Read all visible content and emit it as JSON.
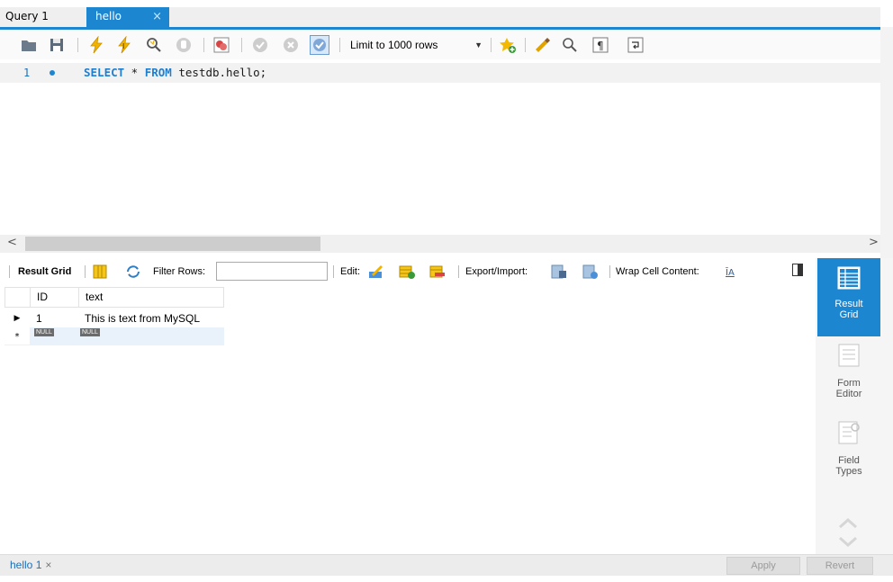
{
  "tabs": [
    {
      "label": "Query 1",
      "active": false
    },
    {
      "label": "hello",
      "active": true,
      "close": "×"
    }
  ],
  "toolbar": {
    "limit_select": "Limit to 1000 rows",
    "icons": [
      "open-folder-icon",
      "save-icon",
      "execute-icon",
      "execute-current-icon",
      "explain-icon",
      "stop-icon",
      "toggle-error-icon",
      "commit-icon",
      "rollback-icon",
      "autocommit-icon",
      "add-snippet-icon",
      "beautify-icon",
      "find-icon",
      "invisible-chars-icon",
      "wrap-lines-icon"
    ]
  },
  "editor": {
    "line_number": "1",
    "code_kw1": "SELECT",
    "code_mid": " * ",
    "code_kw2": "FROM",
    "code_rest": " testdb.hello;"
  },
  "result_toolbar": {
    "result_grid": "Result Grid",
    "filter_rows": "Filter Rows:",
    "edit": "Edit:",
    "export_import": "Export/Import:",
    "wrap_cell": "Wrap Cell Content:"
  },
  "grid": {
    "columns": [
      "ID",
      "text"
    ],
    "rows": [
      {
        "id": "1",
        "text": "This is text from MySQL"
      }
    ],
    "null_label": "NULL",
    "new_row_marker": "*",
    "current_row_marker": "▶"
  },
  "side_panel": {
    "result_grid": [
      "Result",
      "Grid"
    ],
    "form_editor": [
      "Form",
      "Editor"
    ],
    "field_types": [
      "Field",
      "Types"
    ]
  },
  "bottom": {
    "tab_label": "hello 1",
    "tab_close": "×",
    "apply": "Apply",
    "revert": "Revert"
  },
  "scroll": {
    "left": "<",
    "right": ">"
  },
  "colors": {
    "accent": "#1d86d1",
    "keyword": "#1f7fce"
  }
}
